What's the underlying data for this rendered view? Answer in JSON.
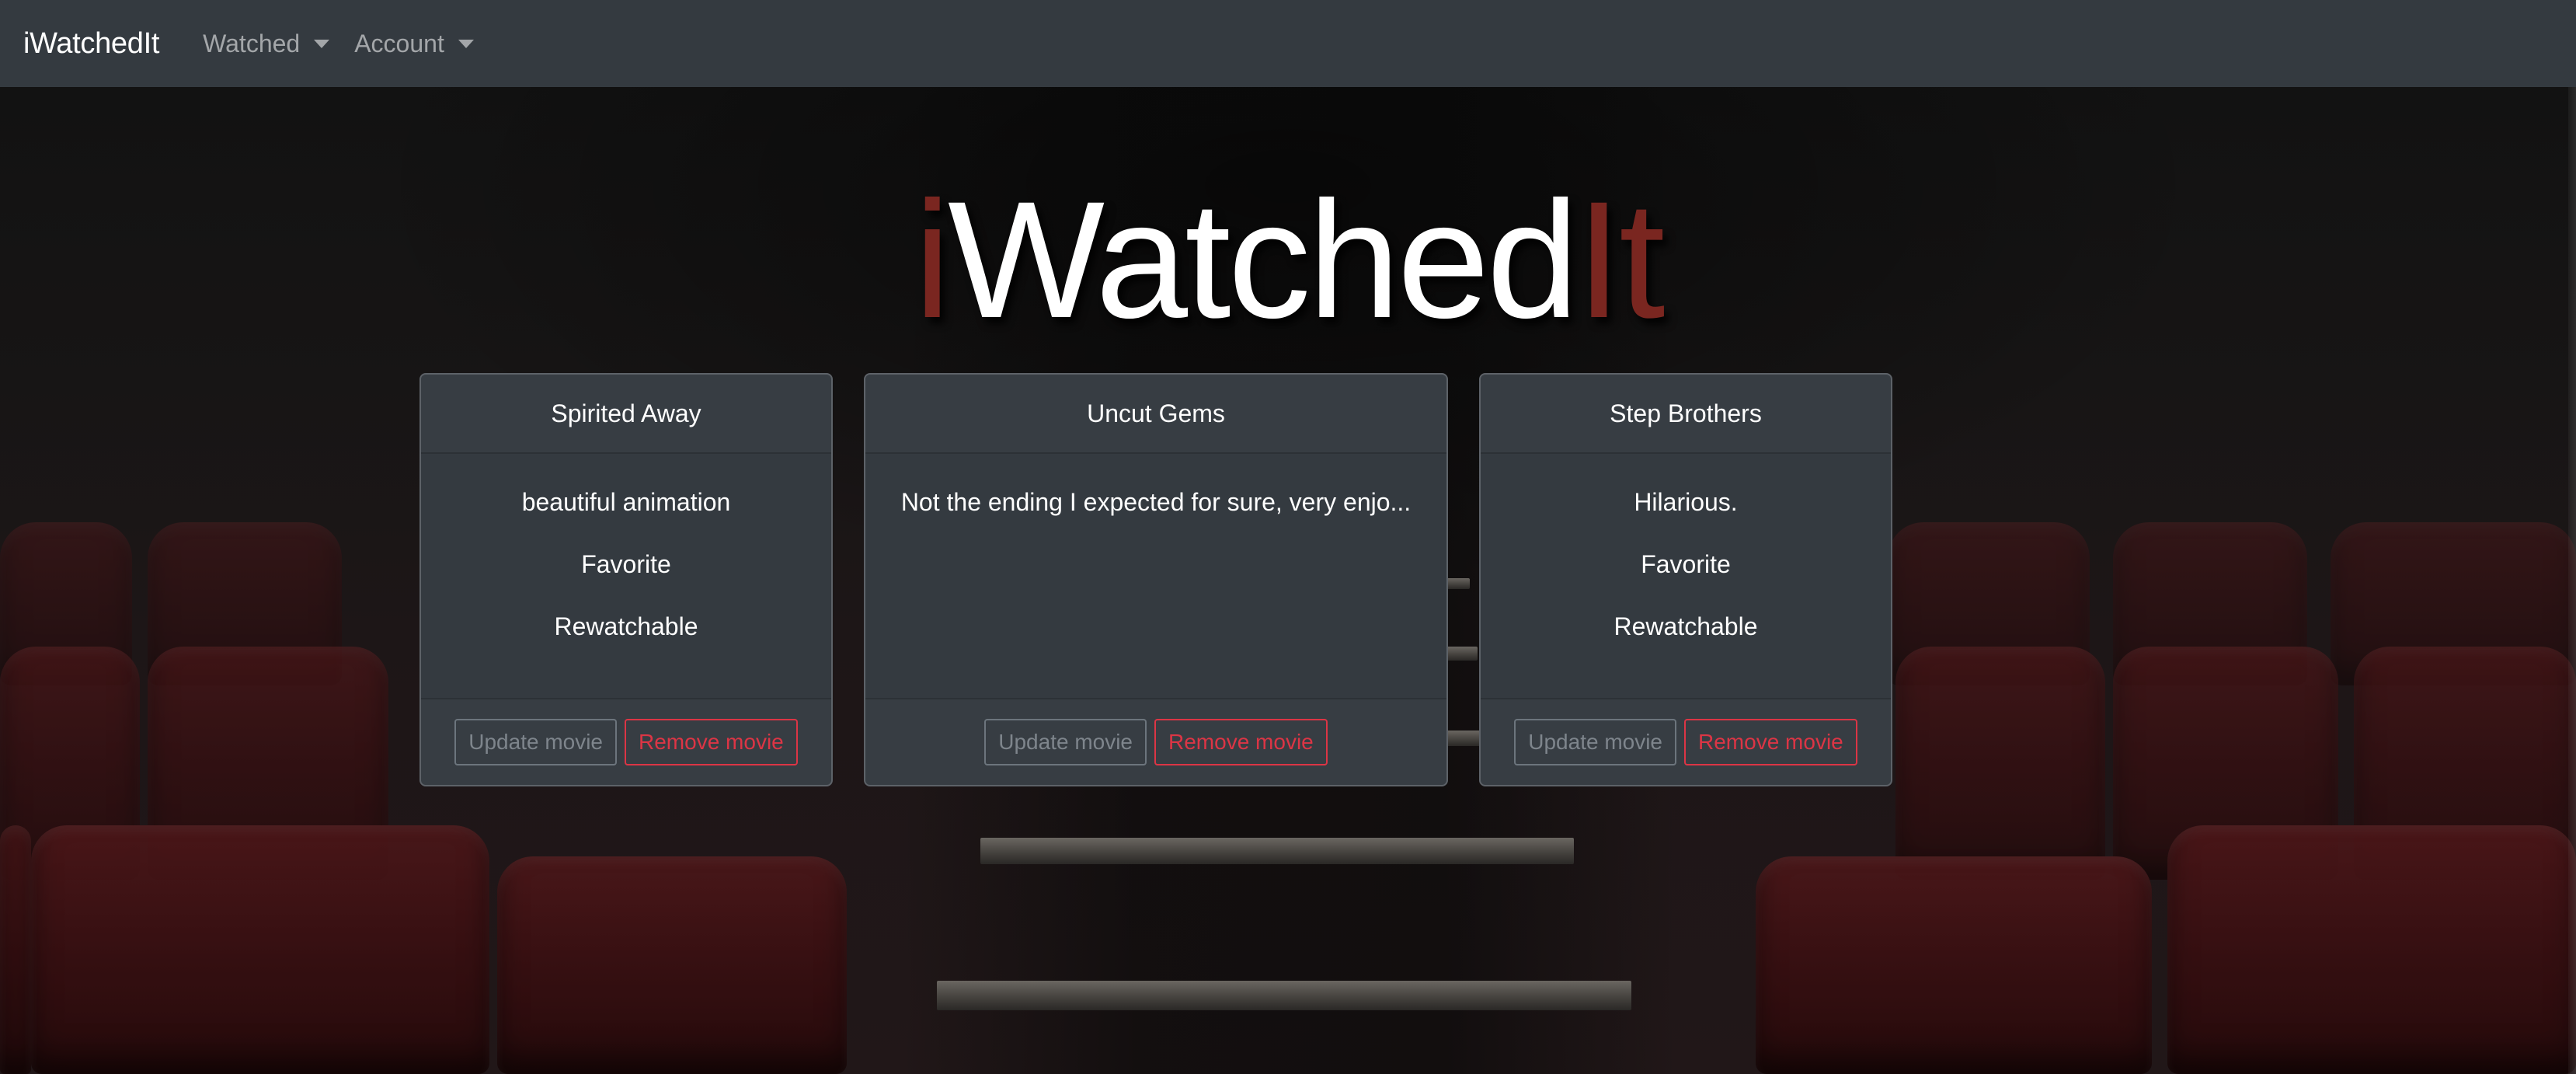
{
  "navbar": {
    "brand": "iWatchedIt",
    "menus": [
      {
        "label": "Watched"
      },
      {
        "label": "Account"
      }
    ]
  },
  "hero": {
    "prefix_accent": "i",
    "middle": "Watched",
    "suffix_accent": "It"
  },
  "colors": {
    "navbar_bg": "#343a40",
    "card_bg": "#343a40",
    "accent_red": "#7a2620",
    "remove_red": "#dc3545",
    "update_gray": "#6c757d"
  },
  "movies": [
    {
      "title": "Spirited Away",
      "review": "beautiful animation",
      "tags": [
        "Favorite",
        "Rewatchable"
      ],
      "update_label": "Update movie",
      "remove_label": "Remove movie"
    },
    {
      "title": "Uncut Gems",
      "review": "Not the ending I expected for sure, very enjo...",
      "tags": [],
      "update_label": "Update movie",
      "remove_label": "Remove movie"
    },
    {
      "title": "Step Brothers",
      "review": "Hilarious.",
      "tags": [
        "Favorite",
        "Rewatchable"
      ],
      "update_label": "Update movie",
      "remove_label": "Remove movie"
    }
  ]
}
